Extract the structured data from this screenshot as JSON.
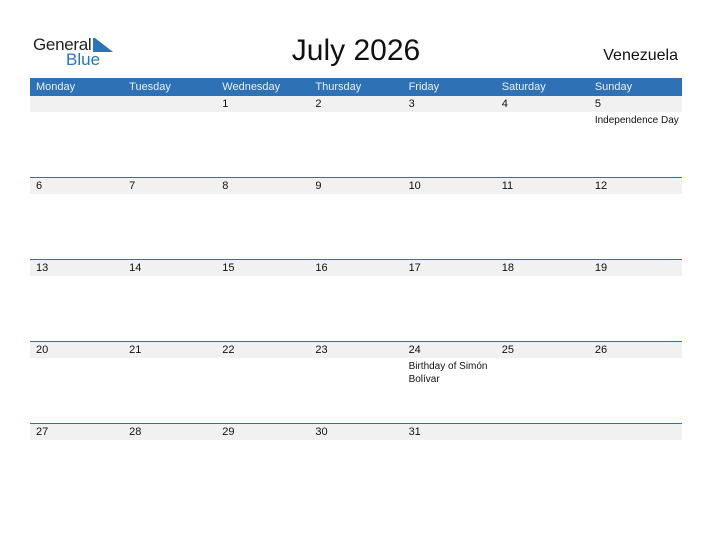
{
  "logo": {
    "word1": "General",
    "word2": "Blue"
  },
  "title": "July 2026",
  "country": "Venezuela",
  "weekdays": [
    "Monday",
    "Tuesday",
    "Wednesday",
    "Thursday",
    "Friday",
    "Saturday",
    "Sunday"
  ],
  "weeks": [
    {
      "days": [
        "",
        "",
        "1",
        "2",
        "3",
        "4",
        "5"
      ],
      "events": [
        "",
        "",
        "",
        "",
        "",
        "",
        "Independence Day"
      ]
    },
    {
      "days": [
        "6",
        "7",
        "8",
        "9",
        "10",
        "11",
        "12"
      ],
      "events": [
        "",
        "",
        "",
        "",
        "",
        "",
        ""
      ]
    },
    {
      "days": [
        "13",
        "14",
        "15",
        "16",
        "17",
        "18",
        "19"
      ],
      "events": [
        "",
        "",
        "",
        "",
        "",
        "",
        ""
      ]
    },
    {
      "days": [
        "20",
        "21",
        "22",
        "23",
        "24",
        "25",
        "26"
      ],
      "events": [
        "",
        "",
        "",
        "",
        "Birthday of Simón Bolívar",
        "",
        ""
      ]
    },
    {
      "days": [
        "27",
        "28",
        "29",
        "30",
        "31",
        "",
        ""
      ],
      "events": [
        "",
        "",
        "",
        "",
        "",
        "",
        ""
      ]
    }
  ]
}
